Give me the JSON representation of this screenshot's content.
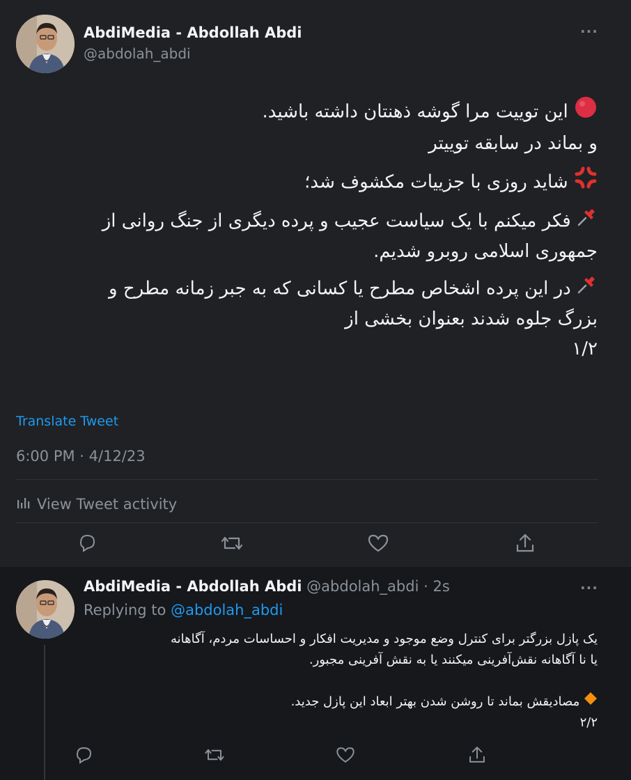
{
  "tweet": {
    "author_name": "AbdiMedia - Abdollah Abdi",
    "author_handle": "@abdolah_abdi",
    "paragraphs": [
      {
        "emoji": "red-circle-icon",
        "line1": "این توییت مرا گوشه ذهنتان داشته باشید.",
        "line2": "و بماند در سابقه توییتر"
      },
      {
        "emoji": "anger-symbol-icon",
        "line1": "شاید روزی با جزییات مکشوف شد؛"
      },
      {
        "emoji": "pushpin-icon",
        "line1": "فکر میکنم با یک سیاست عجیب و پرده دیگری از جنگ روانی از",
        "line2": "جمهوری اسلامی روبرو شدیم."
      },
      {
        "emoji": "pushpin-icon",
        "line1": "در این پرده اشخاص مطرح یا کسانی که به جبر زمانه مطرح و",
        "line2": "بزرگ جلوه شدند بعنوان بخشی از",
        "line3": "۱/۲"
      }
    ],
    "translate_label": "Translate Tweet",
    "timestamp": "6:00 PM · 4/12/23",
    "activity_label": "View Tweet activity"
  },
  "reply": {
    "author_name": "AbdiMedia - Abdollah Abdi",
    "author_handle": "@abdolah_abdi",
    "time_ago": "· 2s",
    "replying_label": "Replying to",
    "replying_to": "@abdolah_abdi",
    "line1": "یک پازل بزرگتر برای کنترل وضع موجود و مدیریت افکار و احساسات مردم، آگاهانه",
    "line2": "یا نا آگاهانه نقش‌آفرینی میکنند یا به نقش آفرینی مجبور.",
    "line3": "مصادیقش بماند تا روشن شدن بهتر ابعاد این پازل جدید.",
    "line3_emoji": "orange-diamond-icon",
    "line4": "۲/۲"
  },
  "more_label": "···",
  "colors": {
    "bg_main": "#202125",
    "bg_reply": "#16181c",
    "accent": "#1d9bf0",
    "muted": "#8b9299"
  }
}
